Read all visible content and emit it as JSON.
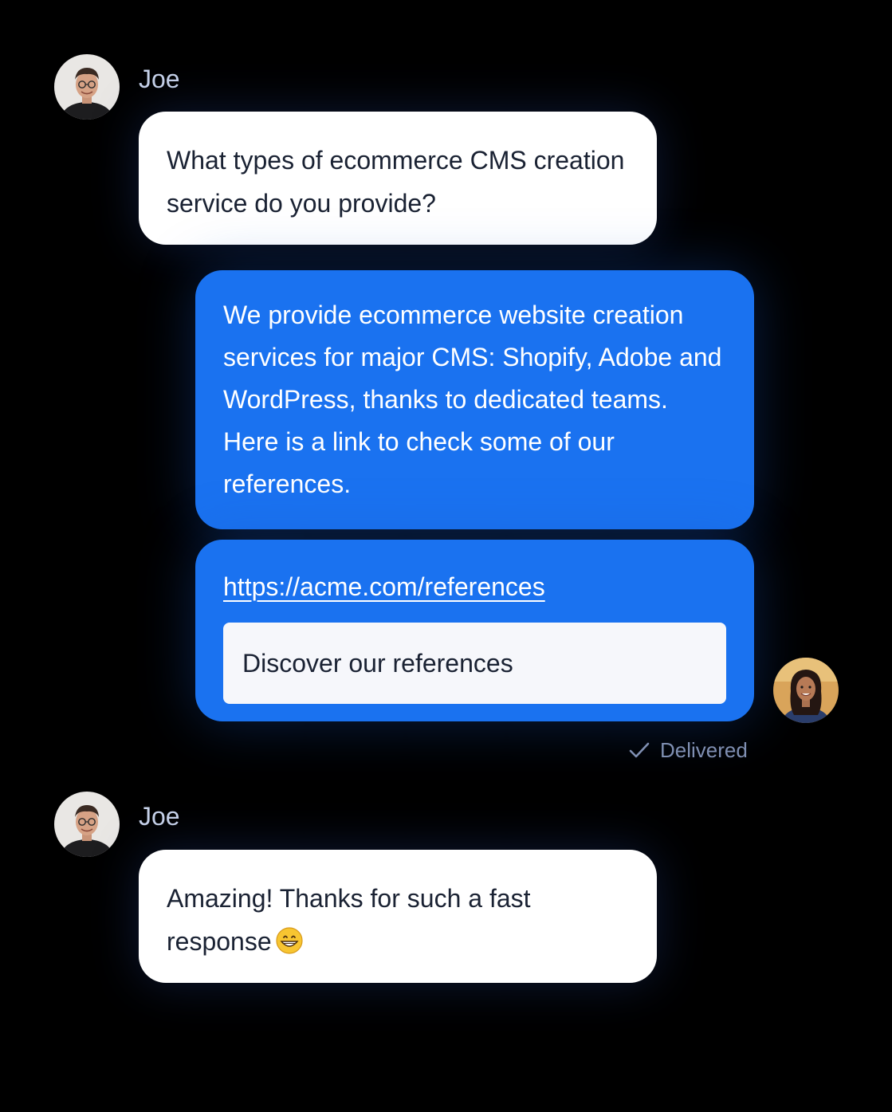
{
  "messages": [
    {
      "sender": "Joe",
      "text": "What types of ecommerce CMS creation service do you provide?"
    },
    {
      "text": "We provide ecommerce website creation services for major CMS: Shopify, Adobe and WordPress, thanks to dedicated teams. Here is a link to check some of our references.",
      "link": "https://acme.com/references",
      "link_card": "Discover our references",
      "status": "Delivered"
    },
    {
      "sender": "Joe",
      "text": "Amazing! Thanks for such a fast response",
      "emoji": "grinning-face-icon"
    }
  ],
  "colors": {
    "background": "#000000",
    "agent_bubble": "#1a72f0",
    "user_bubble": "#ffffff",
    "status_text": "#7f8fb2",
    "name_text": "#c8d3ea"
  }
}
